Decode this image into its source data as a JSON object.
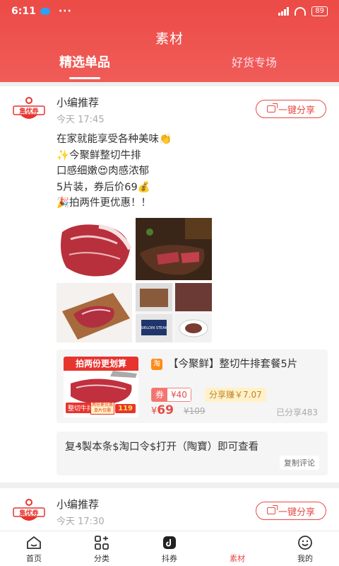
{
  "status_bar": {
    "time": "6:11",
    "dots": "···",
    "battery": "89"
  },
  "header": {
    "title": "素材",
    "tabs": [
      {
        "label": "精选单品",
        "active": true
      },
      {
        "label": "好货专场",
        "active": false
      }
    ]
  },
  "posts": [
    {
      "author": "小编推荐",
      "avatar_text": "集优券",
      "timestamp": "今天 17:45",
      "share_label": "一键分享",
      "lines": [
        "在家就能享受各种美味👏",
        "✨今聚鲜整切牛排",
        "口感细嫩😍肉感浓郁",
        "5片装，券后价69💰",
        "🎉拍两件更优惠！！"
      ],
      "gallery_texts": {
        "steak_box_label": "SIRLOIN STEAK"
      },
      "product": {
        "platform": "淘",
        "banner": "拍两份更划算",
        "image_tag": "整切牛排",
        "image_badge": "119",
        "image_mini": "两份更优惠 单片仅需",
        "title": "【今聚鲜】整切牛排套餐5片",
        "coupon_label": "券",
        "coupon_value": "¥40",
        "earn": "分享赚￥7.07",
        "price_symbol": "¥",
        "price": "69",
        "original_price": "¥109",
        "shared_count": "已分享483"
      },
      "copy_text": "复₰製本条$淘口令$打开（陶寶）即可查看",
      "copy_comment_label": "复制评论"
    },
    {
      "author": "小编推荐",
      "avatar_text": "集优券",
      "timestamp": "今天 17:30",
      "share_label": "一键分享"
    }
  ],
  "tabbar": [
    {
      "label": "首页",
      "icon": "home-icon",
      "active": false
    },
    {
      "label": "分类",
      "icon": "category-icon",
      "active": false
    },
    {
      "label": "抖券",
      "icon": "douquan-icon",
      "active": false
    },
    {
      "label": "素材",
      "icon": "material-icon",
      "active": true
    },
    {
      "label": "我的",
      "icon": "profile-icon",
      "active": false
    }
  ],
  "colors": {
    "brand": "#e64b45",
    "header": "#ec4b46"
  }
}
